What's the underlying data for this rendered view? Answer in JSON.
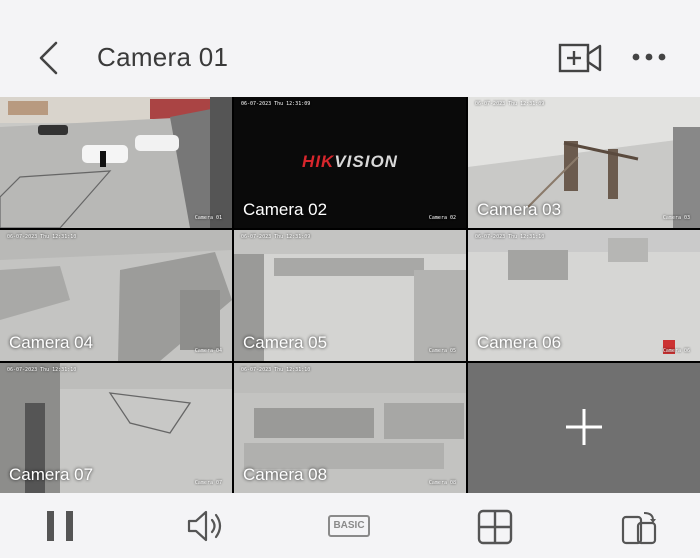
{
  "header": {
    "title": "Camera 01",
    "back_icon": "chevron-left-icon",
    "add_camera_icon": "add-camera-icon",
    "more_icon": "more-horizontal-icon"
  },
  "cameras": [
    {
      "name": "",
      "osd_date": "",
      "osd_cam": "Camera 01",
      "selected": true
    },
    {
      "name": "Camera 02",
      "osd_date": "06-07-2023 Thu 12:31:09",
      "osd_cam": "Camera 02",
      "brand": "HIKVISION"
    },
    {
      "name": "Camera 03",
      "osd_date": "06-07-2023 Thu 12:31:09",
      "osd_cam": "Camera 03"
    },
    {
      "name": "Camera 04",
      "osd_date": "06-07-2023 Thu 12:31:10",
      "osd_cam": "Camera 04"
    },
    {
      "name": "Camera 05",
      "osd_date": "06-07-2023 Thu 12:31:09",
      "osd_cam": "Camera 05"
    },
    {
      "name": "Camera 06",
      "osd_date": "06-07-2023 Thu 12:31:10",
      "osd_cam": "Camera 06"
    },
    {
      "name": "Camera 07",
      "osd_date": "06-07-2023 Thu 12:31:10",
      "osd_cam": "Camera 07"
    },
    {
      "name": "Camera 08",
      "osd_date": "06-07-2023 Thu 12:31:10",
      "osd_cam": "Camera 08"
    }
  ],
  "add_slot_icon": "plus-icon",
  "toolbar": {
    "pause_icon": "pause-icon",
    "volume_icon": "speaker-icon",
    "basic_label": "BASIC",
    "layout_icon": "grid-layout-icon",
    "rotate_icon": "rotate-screen-icon"
  },
  "colors": {
    "selected_border": "#d7262c",
    "brand_red": "#d7262c",
    "background": "#f4f4f6",
    "empty_tile": "#707070"
  }
}
